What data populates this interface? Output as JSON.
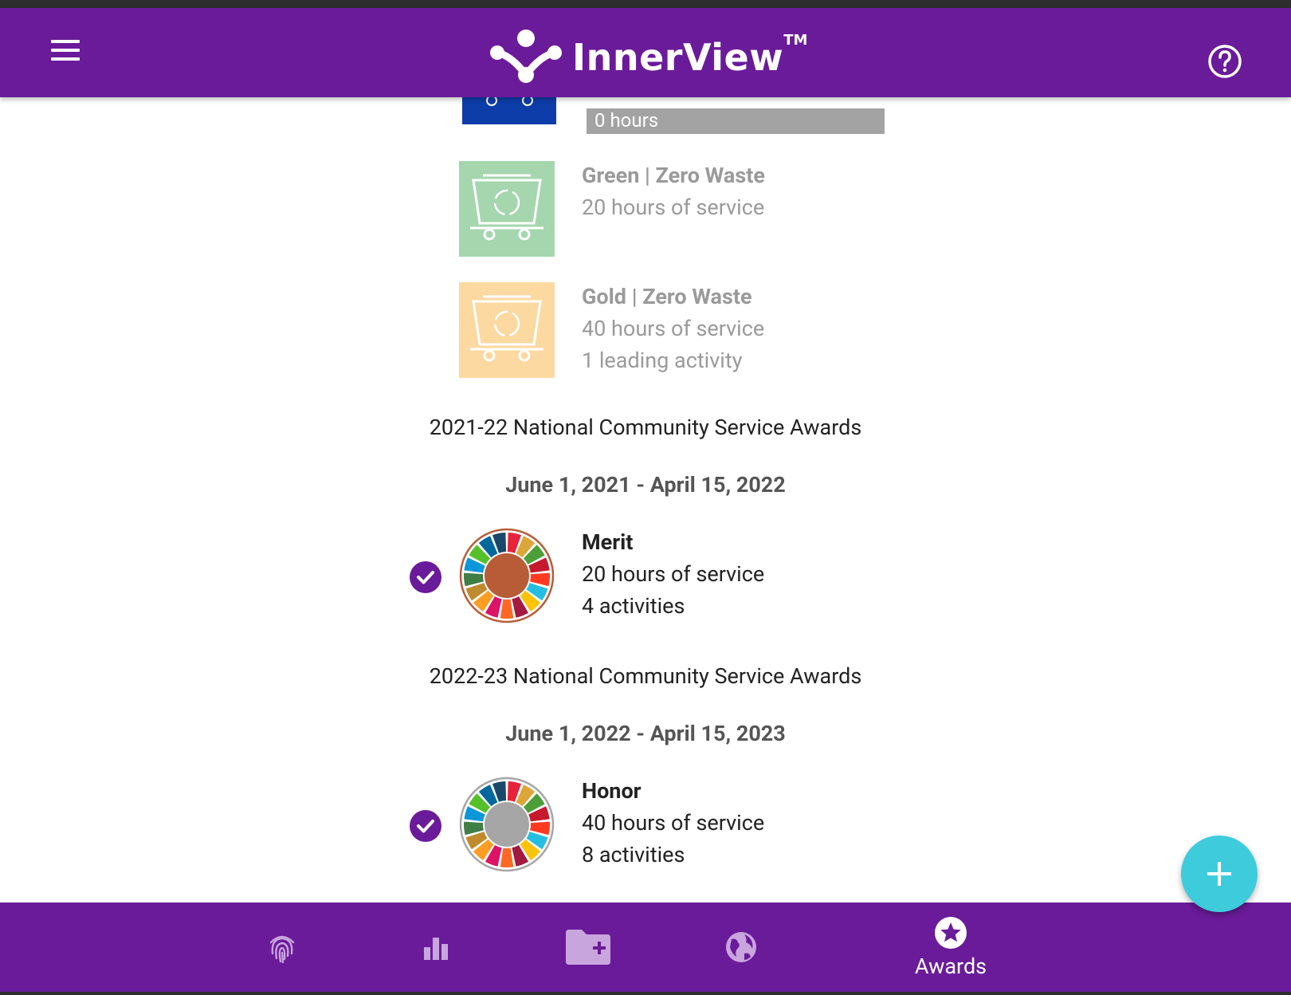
{
  "app": {
    "title": "InnerView",
    "trademark": "TM",
    "colors": {
      "primary": "#6a1b9a",
      "accent": "#3ecbdc"
    }
  },
  "header": {
    "menu_icon": "hamburger-menu-icon",
    "help_icon": "help-circle-icon"
  },
  "awards_partial": {
    "progress_label": "0 hours",
    "progress_value": 0
  },
  "zero_waste": [
    {
      "title": "Green | Zero Waste",
      "lines": [
        "20 hours of service"
      ],
      "color": "#a5d6ae",
      "achieved": false
    },
    {
      "title": "Gold | Zero Waste",
      "lines": [
        "40 hours of service",
        "1 leading activity"
      ],
      "color": "#fbd9a0",
      "achieved": false
    }
  ],
  "national_awards": [
    {
      "section_title": "2021-22 National Community Service Awards",
      "date_range": "June 1, 2021 - April 15, 2022",
      "award": {
        "title": "Merit",
        "lines": [
          "20 hours of service",
          "4 activities"
        ],
        "center_color": "#b85c38",
        "achieved": true
      }
    },
    {
      "section_title": "2022-23 National Community Service Awards",
      "date_range": "June 1, 2022 - April 15, 2023",
      "award": {
        "title": "Honor",
        "lines": [
          "40 hours of service",
          "8 activities"
        ],
        "center_color": "#a6a6a6",
        "achieved": true
      }
    }
  ],
  "fab": {
    "icon": "plus-icon"
  },
  "bottom_nav": [
    {
      "icon": "fingerprint-icon",
      "label": ""
    },
    {
      "icon": "bar-chart-icon",
      "label": ""
    },
    {
      "icon": "folder-add-icon",
      "label": ""
    },
    {
      "icon": "globe-icon",
      "label": ""
    },
    {
      "icon": "star-circle-icon",
      "label": "Awards",
      "active": true
    }
  ]
}
